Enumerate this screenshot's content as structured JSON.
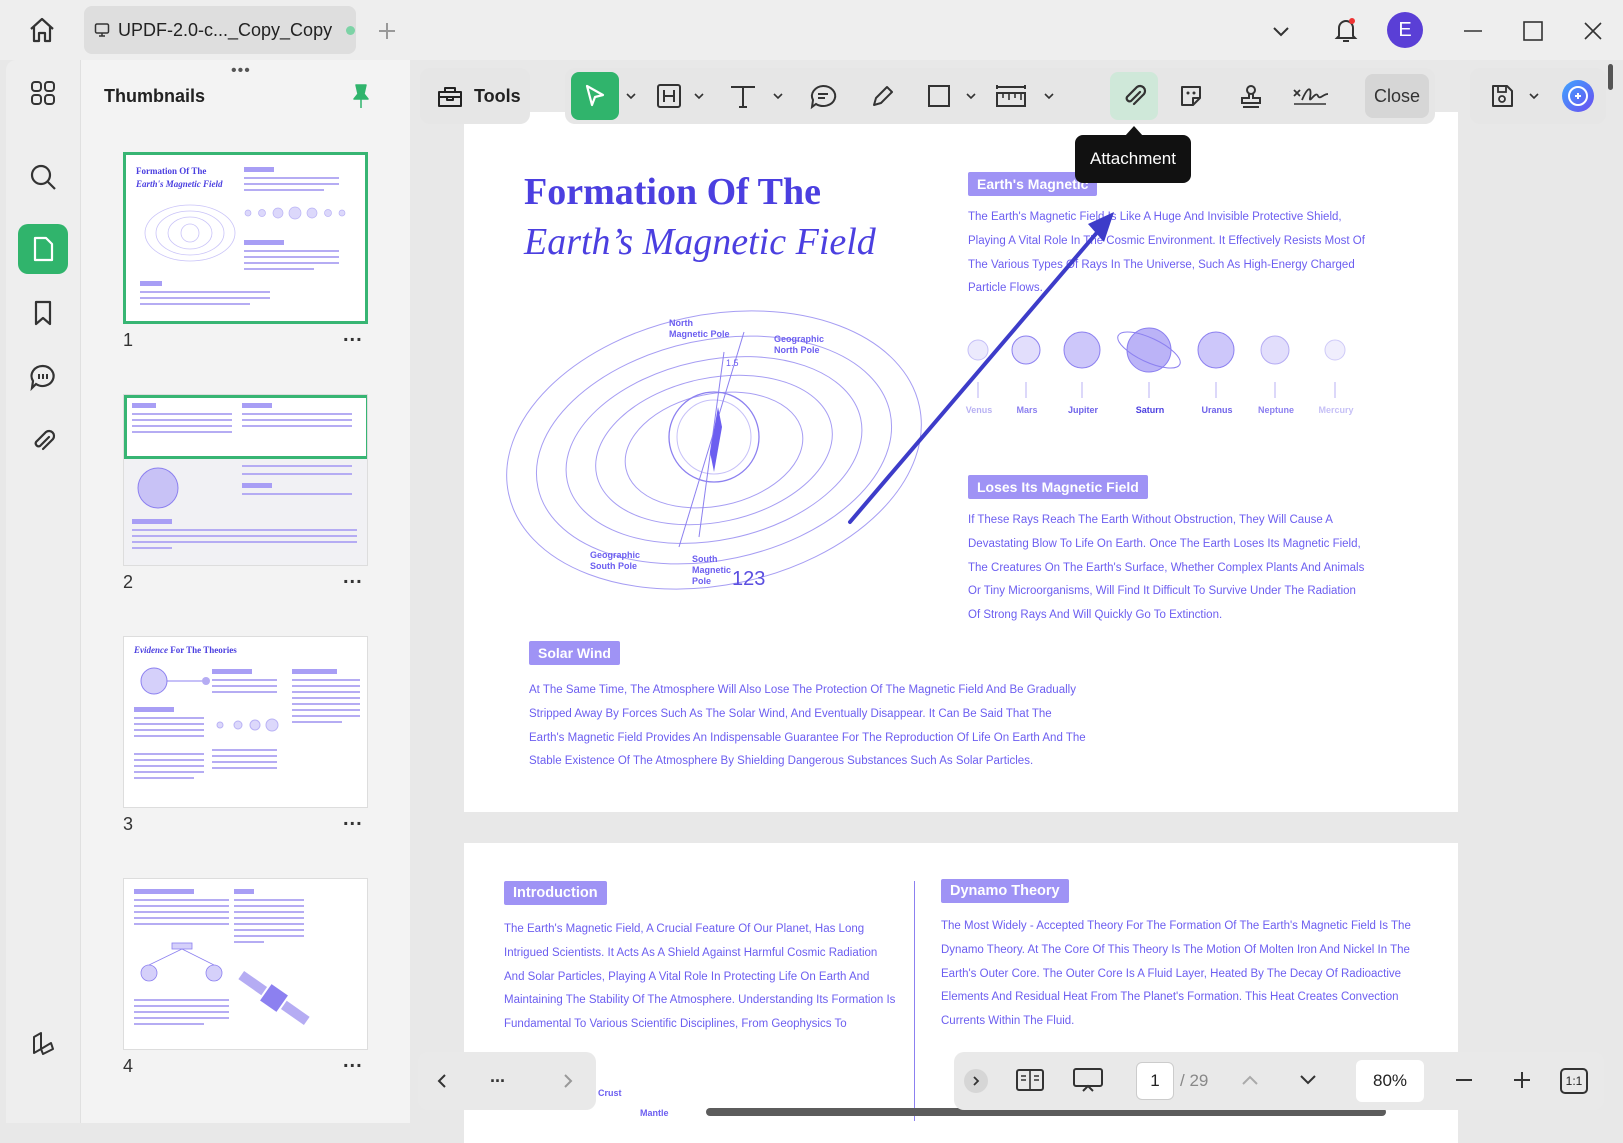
{
  "titlebar": {
    "tab_title": "UPDF-2.0-c..._Copy_Copy",
    "avatar_letter": "E"
  },
  "sidebar": {
    "title": "Thumbnails",
    "thumbnails": [
      {
        "label": "1",
        "more": "..."
      },
      {
        "label": "2",
        "more": "..."
      },
      {
        "label": "3",
        "more": "..."
      },
      {
        "label": "4",
        "more": "..."
      }
    ]
  },
  "toolbar": {
    "tools_label": "Tools",
    "close_label": "Close",
    "tooltip": "Attachment"
  },
  "page1": {
    "title_line1": "Formation Of The",
    "title_line2": "Earth’s Magnetic Field",
    "section1_badge": "Earth's Magnetic",
    "section1_text": "The Earth's Magnetic Field Is Like A Huge And Invisible Protective Shield, Playing A Vital Role In The Cosmic Environment. It Effectively Resists Most Of The Various Types Of Rays In The Universe, Such As High-Energy Charged Particle Flows.",
    "section2_badge": "Loses Its Magnetic Field",
    "section2_text": "If These Rays Reach The Earth Without Obstruction, They Will Cause A Devastating Blow To Life On Earth. Once The Earth Loses Its Magnetic Field, The Creatures On The Earth's Surface, Whether Complex Plants And Animals Or Tiny Microorganisms, Will Find It Difficult To Survive Under The Radiation Of Strong Rays And Will Quickly Go To Extinction.",
    "section3_badge": "Solar Wind",
    "section3_text": "At The Same Time, The Atmosphere Will Also Lose The Protection Of The Magnetic Field And Be Gradually Stripped Away By Forces Such As The Solar Wind, And Eventually Disappear. It Can Be Said That The Earth's Magnetic Field Provides An Indispensable Guarantee For The Reproduction Of Life On Earth And The Stable Existence Of The Atmosphere By Shielding Dangerous Substances Such As Solar Particles.",
    "planets": [
      "Venus",
      "Mars",
      "Jupiter",
      "Saturn",
      "Uranus",
      "Neptune",
      "Mercury"
    ],
    "diagram_labels": {
      "north_magnetic": "North Magnetic Pole",
      "geographic_north": "Geographic North Pole",
      "geographic_south": "Geographic South Pole",
      "south_magnetic": "South Magnetic Pole",
      "angle": "1.5",
      "annotation": "123"
    }
  },
  "page2": {
    "intro_badge": "Introduction",
    "intro_text": "The Earth's Magnetic Field, A Crucial Feature Of Our Planet, Has Long Intrigued Scientists. It Acts As A Shield Against Harmful Cosmic Radiation And Solar Particles, Playing A Vital Role In Protecting Life On Earth And Maintaining The Stability Of The Atmosphere. Understanding Its Formation Is Fundamental To Various Scientific Disciplines, From Geophysics To",
    "dynamo_badge": "Dynamo Theory",
    "dynamo_text": "The Most Widely - Accepted Theory For The Formation Of The Earth's Magnetic Field Is The Dynamo Theory. At The Core Of This Theory Is The Motion Of Molten Iron And Nickel In The Earth's Outer Core. The Outer Core Is A Fluid Layer, Heated By The Decay Of Radioactive Elements And Residual Heat From The Planet's Formation. This Heat Creates Convection Currents Within The Fluid.",
    "crust_label": "Crust",
    "mantle_label": "Mantle"
  },
  "pagebar": {
    "current_page": "1",
    "total_pages": "/ 29",
    "zoom": "80%",
    "nav_more": "...",
    "fit_label": "1:1"
  },
  "colors": {
    "accent_green": "#30b46c",
    "doc_purple": "#6c5ef0",
    "badge_purple": "#9f93f5",
    "arrow_blue": "#3d3cc9"
  }
}
